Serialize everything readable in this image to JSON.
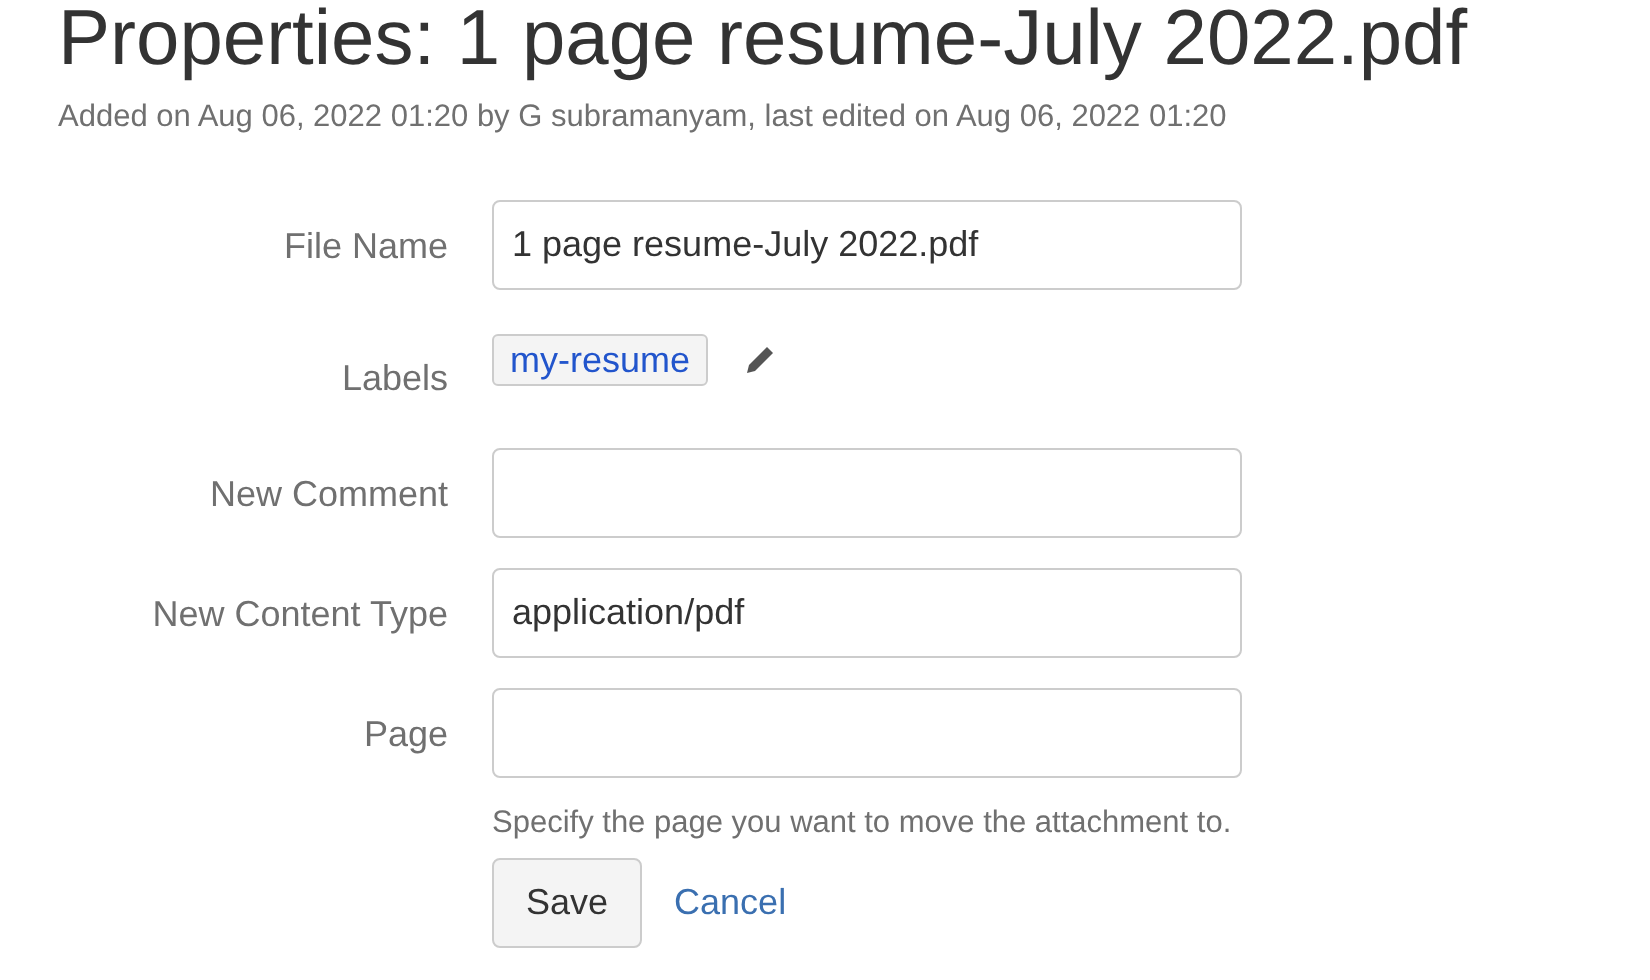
{
  "title": "Properties: 1 page resume-July 2022.pdf",
  "subtitle": "Added on Aug 06, 2022 01:20 by G subramanyam, last edited on Aug 06, 2022 01:20",
  "fields": [
    {
      "kind": "text",
      "label": "File Name",
      "value": "1 page resume-July 2022.pdf"
    },
    {
      "kind": "labels",
      "label": "Labels",
      "labels": [
        "my-resume"
      ]
    },
    {
      "kind": "text",
      "label": "New Comment"
    },
    {
      "kind": "text",
      "label": "New Content Type",
      "value": "application/pdf"
    },
    {
      "kind": "text",
      "label": "Page",
      "hint": "Specify the page you want to move the attachment to."
    }
  ],
  "buttons": {
    "save": "Save",
    "cancel": "Cancel"
  }
}
